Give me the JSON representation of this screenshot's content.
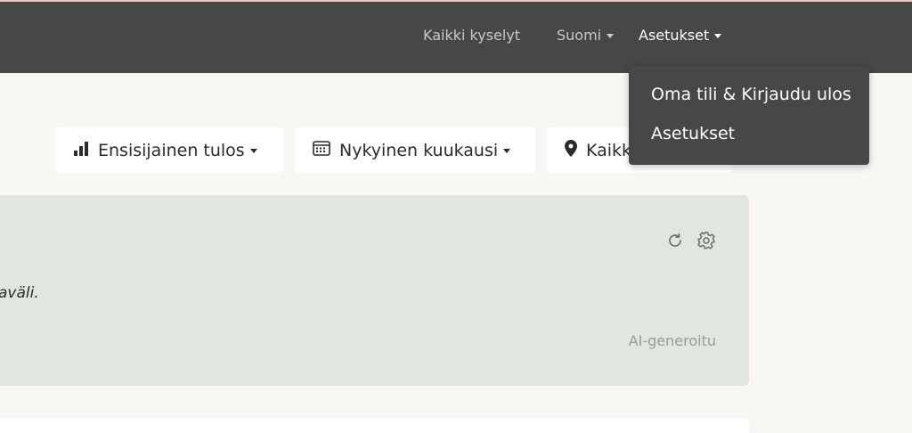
{
  "navbar": {
    "all_surveys": "Kaikki kyselyt",
    "language": "Suomi",
    "settings": "Asetukset"
  },
  "settings_menu": {
    "items": [
      {
        "label": "Oma tili & Kirjaudu ulos"
      },
      {
        "label": "Asetukset"
      }
    ]
  },
  "filters": {
    "metric": {
      "label": "Ensisijainen tulos",
      "icon": "bar-chart-icon"
    },
    "period": {
      "label": "Nykyinen kuukausi",
      "icon": "calendar-icon"
    },
    "location": {
      "label": "Kaikki",
      "icon": "map-marker-icon"
    }
  },
  "summary_card": {
    "text": "aväli.",
    "tag": "AI-generoitu",
    "icons": [
      "refresh-icon",
      "gear-icon"
    ]
  },
  "colors": {
    "navbar_bg": "#474747",
    "page_bg": "#f8f7f4",
    "card_bg": "#e2e6e0"
  }
}
